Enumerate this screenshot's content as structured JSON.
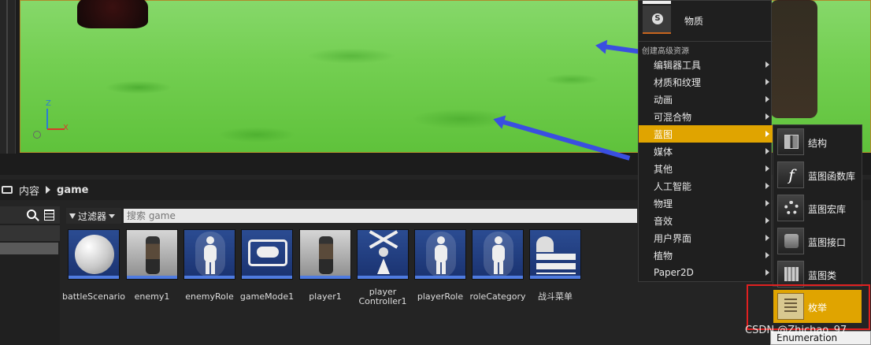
{
  "breadcrumb": {
    "root": "内容",
    "current": "game"
  },
  "filter": {
    "label": "过滤器",
    "search_placeholder": "搜索 game"
  },
  "assets": [
    {
      "label": "battleScenario",
      "icon": "sphere-icon"
    },
    {
      "label": "enemy1",
      "icon": "soldier-icon"
    },
    {
      "label": "enemyRole",
      "icon": "pawn-icon"
    },
    {
      "label": "gameMode1",
      "icon": "gamepad-icon"
    },
    {
      "label": "player1",
      "icon": "soldier-icon"
    },
    {
      "label": "player Controller1",
      "icon": "controller-icon"
    },
    {
      "label": "playerRole",
      "icon": "pawn-icon"
    },
    {
      "label": "roleCategory",
      "icon": "pawn-icon"
    },
    {
      "label": "战斗菜单",
      "icon": "heart-list-icon"
    }
  ],
  "menu": {
    "top_item": "物质",
    "section_header": "创建高级资源",
    "items": [
      {
        "label": "编辑器工具"
      },
      {
        "label": "材质和纹理"
      },
      {
        "label": "动画"
      },
      {
        "label": "可混合物"
      },
      {
        "label": "蓝图",
        "active": true
      },
      {
        "label": "媒体"
      },
      {
        "label": "其他"
      },
      {
        "label": "人工智能"
      },
      {
        "label": "物理"
      },
      {
        "label": "音效"
      },
      {
        "label": "用户界面"
      },
      {
        "label": "植物"
      },
      {
        "label": "Paper2D"
      }
    ]
  },
  "submenu": {
    "items": [
      {
        "label": "结构",
        "icon": "struct-icon"
      },
      {
        "label": "蓝图函数库",
        "icon": "function-library-icon"
      },
      {
        "label": "蓝图宏库",
        "icon": "macro-library-icon"
      },
      {
        "label": "蓝图接口",
        "icon": "interface-icon"
      },
      {
        "label": "蓝图类",
        "icon": "blueprint-class-icon"
      }
    ],
    "enum_label": "枚举"
  },
  "tooltip": "Enumeration",
  "watermark": "CSDN @Zhichao_97",
  "gizmo": {
    "z": "Z",
    "x": "X"
  },
  "colors": {
    "accent": "#e0a400",
    "highlight_border": "#e02020",
    "asset_bar": "#4f7be0"
  }
}
